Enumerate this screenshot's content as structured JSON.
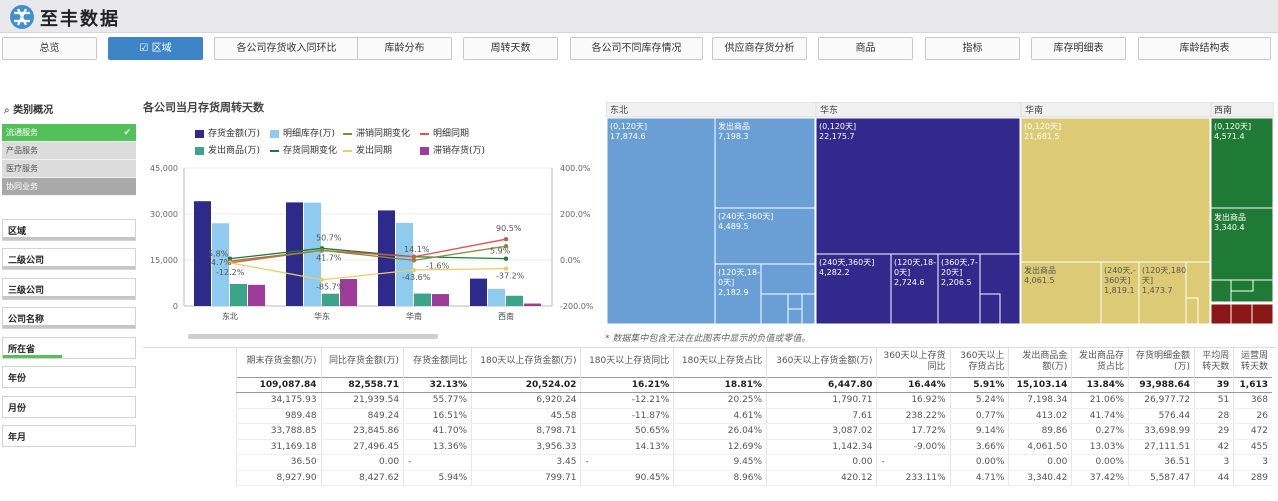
{
  "brand": {
    "name": "至丰数据"
  },
  "tabs": [
    {
      "label": "总览",
      "active": false
    },
    {
      "label": "☑ 区域",
      "active": true
    },
    {
      "label": "各公司存货收入同环比",
      "active": false
    },
    {
      "label": "库龄分布",
      "active": false
    },
    {
      "label": "周转天数",
      "active": false
    },
    {
      "label": "各公司不同库存情况",
      "active": false
    },
    {
      "label": "供应商存货分析",
      "active": false
    },
    {
      "label": "商品",
      "active": false
    },
    {
      "label": "指标",
      "active": false
    },
    {
      "label": "库存明细表",
      "active": false
    },
    {
      "label": "库龄结构表",
      "active": false
    }
  ],
  "left_panel": {
    "header": "类别概况",
    "categories": [
      "流通服务",
      "产品服务",
      "医疗服务",
      "协同业务"
    ],
    "check": "✔",
    "filters": [
      "区域",
      "二级公司",
      "三级公司",
      "公司名称",
      "所在省",
      "年份",
      "月份",
      "年月"
    ]
  },
  "chart": {
    "title": "各公司当月存货周转天数",
    "legend": [
      {
        "label": "存货金额(万)",
        "color": "#2e2a8c"
      },
      {
        "label": "明细库存(万)",
        "color": "#8ecbef"
      },
      {
        "label": "滞销同期变化",
        "color": "#8a8a3a"
      },
      {
        "label": "明细同期",
        "color": "#d9534f"
      },
      {
        "label": "发出商品(万)",
        "color": "#3aa58a"
      },
      {
        "label": "存货同期变化",
        "color": "#1e7b35"
      },
      {
        "label": "发出同期",
        "color": "#e8cf6a"
      },
      {
        "label": "滞销存货(万)",
        "color": "#9e3c9a"
      }
    ],
    "left_ticks": [
      "45,000",
      "30,000",
      "15,000",
      "0"
    ],
    "right_ticks": [
      "400.0%",
      "200.0%",
      "0.0%",
      "-200.0%"
    ],
    "categories": [
      "东北",
      "华东",
      "华南",
      "西南"
    ],
    "data_labels": [
      "5.8%",
      "-4.7%",
      "-12.2%",
      "50.7%",
      "41.7%",
      "-85.7%",
      "14.1%",
      "-1.6%",
      "-43.6%",
      "90.5%",
      "5.9%",
      "-37.2%"
    ]
  },
  "chart_data": {
    "type": "bar",
    "categories": [
      "东北",
      "华东",
      "华南",
      "西南"
    ],
    "ylim": [
      0,
      45000
    ],
    "y2lim": [
      -200,
      400
    ],
    "series": [
      {
        "name": "存货金额(万)",
        "values": [
          34176,
          33789,
          31169,
          8928
        ]
      },
      {
        "name": "明细库存(万)",
        "values": [
          26978,
          33699,
          27111,
          5587
        ]
      },
      {
        "name": "发出商品(万)",
        "values": [
          7198,
          4000,
          4061,
          3340
        ]
      },
      {
        "name": "滞销存货(万)",
        "values": [
          6900,
          8800,
          3900,
          800
        ]
      },
      {
        "name": "存货同期变化",
        "axis": "right",
        "values": [
          5.8,
          50.7,
          14.1,
          5.9
        ]
      },
      {
        "name": "明细同期",
        "axis": "right",
        "values": [
          -4.7,
          41.7,
          14.1,
          90.5
        ]
      },
      {
        "name": "滞销同期变化",
        "axis": "right",
        "values": [
          -12.2,
          41.7,
          -1.6,
          60.0
        ]
      },
      {
        "name": "发出同期",
        "axis": "right",
        "values": [
          -12.2,
          -85.7,
          -43.6,
          -37.2
        ]
      }
    ]
  },
  "treemap": {
    "regions": [
      "东北",
      "华东",
      "华南",
      "西南"
    ],
    "cells": [
      {
        "label": "(0,120天]",
        "value": "17,874.6"
      },
      {
        "label": "发出商品",
        "value": "7,198.3"
      },
      {
        "label": "(240天,360天]",
        "value": "4,489.5"
      },
      {
        "label": "(120天,18-0天]",
        "value": "2,182.9"
      },
      {
        "label": "(0,120天]",
        "value": "22,175.7"
      },
      {
        "label": "(240天,360天]",
        "value": "4,282.2"
      },
      {
        "label": "(120天,18-0天]",
        "value": "2,724.6"
      },
      {
        "label": "(360天,7-20天]",
        "value": "2,206.5"
      },
      {
        "label": "(0,120天]",
        "value": "21,681.5"
      },
      {
        "label": "发出商品",
        "value": "4,061.5"
      },
      {
        "label": "(240天,-360天]",
        "value": "1,819.1"
      },
      {
        "label": "(120天,180-天]",
        "value": "1,473.7"
      },
      {
        "label": "(0,120天]",
        "value": "4,571.4"
      },
      {
        "label": "发出商品",
        "value": "3,340.4"
      }
    ],
    "note": "* 数据集中包含无法在此图表中显示的负值或零值。"
  },
  "table": {
    "headers": [
      "期末存货金额(万)",
      "同比存货金额(万)",
      "存货金额同比",
      "180天以上存货金额(万)",
      "180天以上存货同比",
      "180天以上存货占比",
      "360天以上存货金额(万)",
      "360天以上存货同比",
      "360天以上存货占比",
      "发出商品金额(万)",
      "发出商品存货占比",
      "存货明细金额(万)",
      "平均周转天数",
      "运营周转天数"
    ],
    "total": [
      "109,087.84",
      "82,558.71",
      "32.13%",
      "20,524.02",
      "16.21%",
      "18.81%",
      "6,447.80",
      "16.44%",
      "5.91%",
      "15,103.14",
      "13.84%",
      "93,988.64",
      "39",
      "1,613"
    ],
    "rows": [
      [
        "34,175.93",
        "21,939.54",
        "55.77%",
        "6,920.24",
        "-12.21%",
        "20.25%",
        "1,790.71",
        "16.92%",
        "5.24%",
        "7,198.34",
        "21.06%",
        "26,977.72",
        "51",
        "368"
      ],
      [
        "989.48",
        "849.24",
        "16.51%",
        "45.58",
        "-11.87%",
        "4.61%",
        "7.61",
        "238.22%",
        "0.77%",
        "413.02",
        "41.74%",
        "576.44",
        "28",
        "26"
      ],
      [
        "33,788.85",
        "23,845.86",
        "41.70%",
        "8,798.71",
        "50.65%",
        "26.04%",
        "3,087.02",
        "17.72%",
        "9.14%",
        "89.86",
        "0.27%",
        "33,698.99",
        "29",
        "472"
      ],
      [
        "31,169.18",
        "27,496.45",
        "13.36%",
        "3,956.33",
        "14.13%",
        "12.69%",
        "1,142.34",
        "-9.00%",
        "3.66%",
        "4,061.50",
        "13.03%",
        "27,111.51",
        "42",
        "455"
      ],
      [
        "36.50",
        "0.00",
        "-",
        "3.45",
        "-",
        "9.45%",
        "0.00",
        "-",
        "0.00%",
        "0.00",
        "0.00%",
        "36.51",
        "3",
        "3"
      ],
      [
        "8,927.90",
        "8,427.62",
        "5.94%",
        "799.71",
        "90.45%",
        "8.96%",
        "420.12",
        "233.11%",
        "4.71%",
        "3,340.42",
        "37.42%",
        "5,587.47",
        "44",
        "289"
      ]
    ]
  }
}
